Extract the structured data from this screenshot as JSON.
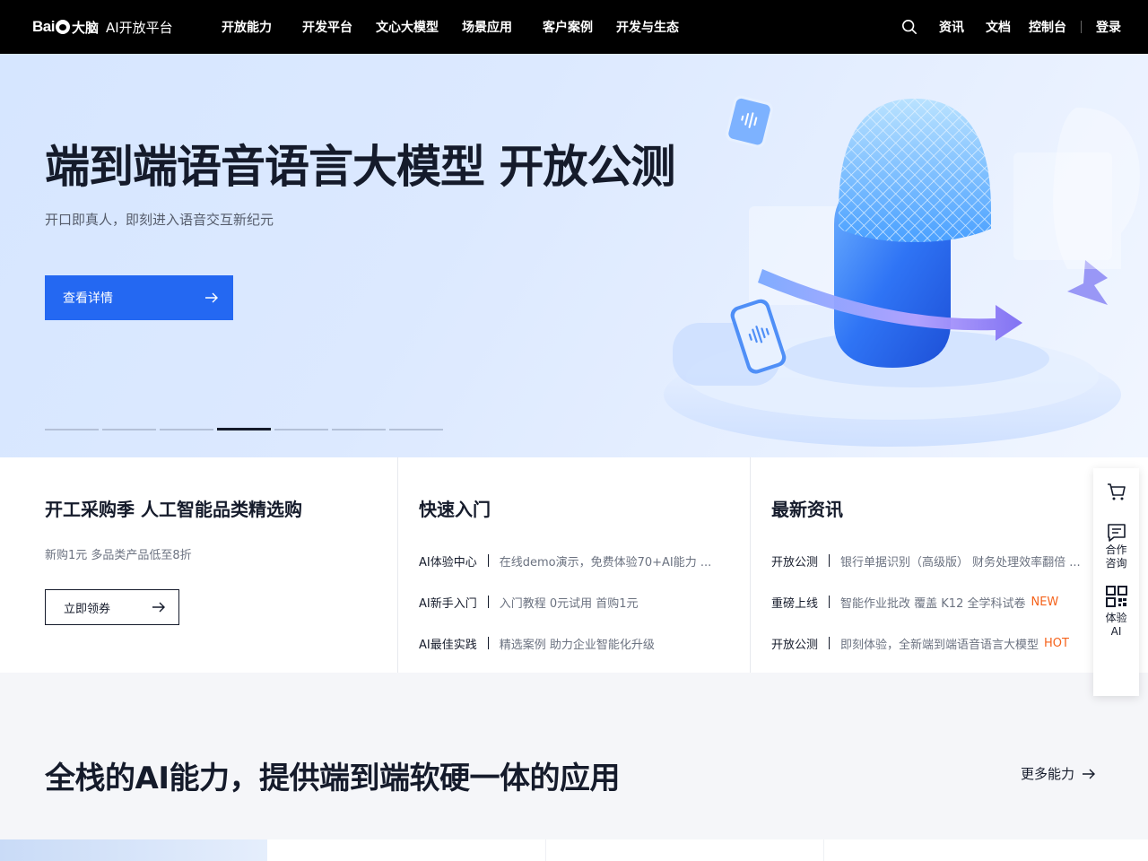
{
  "header": {
    "logo_text": "Bai",
    "logo_du": "du",
    "logo_cn": "大脑",
    "logo_sub": "AI开放平台",
    "nav": [
      "开放能力",
      "开发平台",
      "文心大模型",
      "场景应用",
      "客户案例",
      "开发与生态"
    ],
    "right": {
      "news": "资讯",
      "docs": "文档",
      "console": "控制台",
      "login": "登录"
    }
  },
  "hero": {
    "title": "端到端语音语言大模型 开放公测",
    "subtitle": "开口即真人，即刻进入语音交互新纪元",
    "button": "查看详情",
    "slides_total": 7,
    "active_slide": 4
  },
  "promo": {
    "title": "开工采购季 人工智能品类精选购",
    "subtitle": "新购1元 多品类产品低至8折",
    "button": "立即领券"
  },
  "quick_start": {
    "title": "快速入门",
    "items": [
      {
        "key": "AI体验中心",
        "value": "在线demo演示，免费体验70+AI能力 ..."
      },
      {
        "key": "AI新手入门",
        "value": "入门教程 0元试用 首购1元"
      },
      {
        "key": "AI最佳实践",
        "value": "精选案例 助力企业智能化升级"
      }
    ]
  },
  "news": {
    "title": "最新资讯",
    "items": [
      {
        "key": "开放公测",
        "value": "银行单据识别（高级版） 财务处理效率翻倍 ...",
        "tag": ""
      },
      {
        "key": "重磅上线",
        "value": "智能作业批改 覆盖 K12 全学科试卷",
        "tag": "NEW"
      },
      {
        "key": "开放公测",
        "value": "即刻体验，全新端到端语音语言大模型",
        "tag": "HOT"
      }
    ]
  },
  "float_bar": {
    "consult": "合作咨询",
    "experience": "体验AI"
  },
  "section": {
    "title": "全栈的AI能力，提供端到端软硬一体的应用",
    "more": "更多能力"
  },
  "colors": {
    "primary": "#2468f2",
    "header_bg": "#000000",
    "tag": "#f5631c"
  }
}
